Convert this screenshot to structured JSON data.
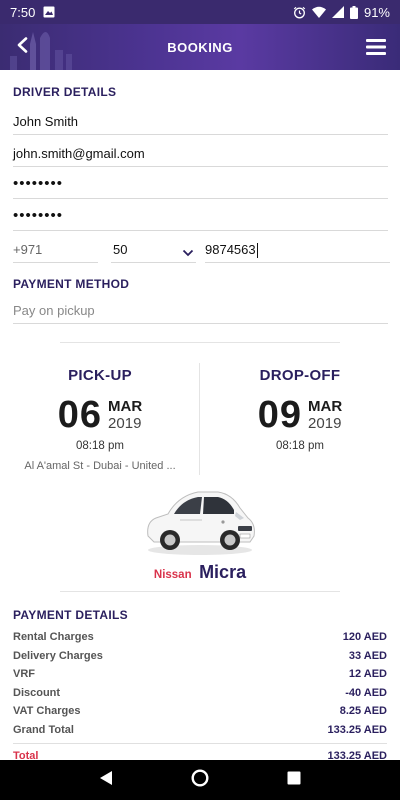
{
  "status_bar": {
    "time": "7:50",
    "battery": "91%"
  },
  "app_bar": {
    "title": "BOOKING"
  },
  "driver": {
    "section_title": "DRIVER DETAILS",
    "name": "John Smith",
    "email": "john.smith@gmail.com",
    "password": "••••••••",
    "confirm_password": "••••••••",
    "phone_country_code": "+971",
    "phone_prefix": "50",
    "phone_number": "9874563"
  },
  "payment_method": {
    "section_title": "PAYMENT METHOD",
    "value": "Pay on pickup"
  },
  "pickup": {
    "label": "PICK-UP",
    "day": "06",
    "month": "MAR",
    "year": "2019",
    "time": "08:18 pm",
    "address": "Al A'amal St - Dubai - United ..."
  },
  "dropoff": {
    "label": "DROP-OFF",
    "day": "09",
    "month": "MAR",
    "year": "2019",
    "time": "08:18 pm"
  },
  "car": {
    "make": "Nissan",
    "model": "Micra"
  },
  "payment_details": {
    "section_title": "PAYMENT DETAILS",
    "rows": [
      {
        "label": "Rental Charges",
        "amount": "120 AED"
      },
      {
        "label": "Delivery Charges",
        "amount": "33 AED"
      },
      {
        "label": "VRF",
        "amount": "12 AED"
      },
      {
        "label": "Discount",
        "amount": "-40 AED"
      },
      {
        "label": "VAT Charges",
        "amount": "8.25 AED"
      },
      {
        "label": "Grand Total",
        "amount": "133.25 AED"
      }
    ],
    "total": {
      "label": "Total",
      "amount": "133.25 AED"
    }
  },
  "colors": {
    "primary": "#2a1f5e",
    "accent": "#d9334b",
    "header": "#4b3390"
  }
}
